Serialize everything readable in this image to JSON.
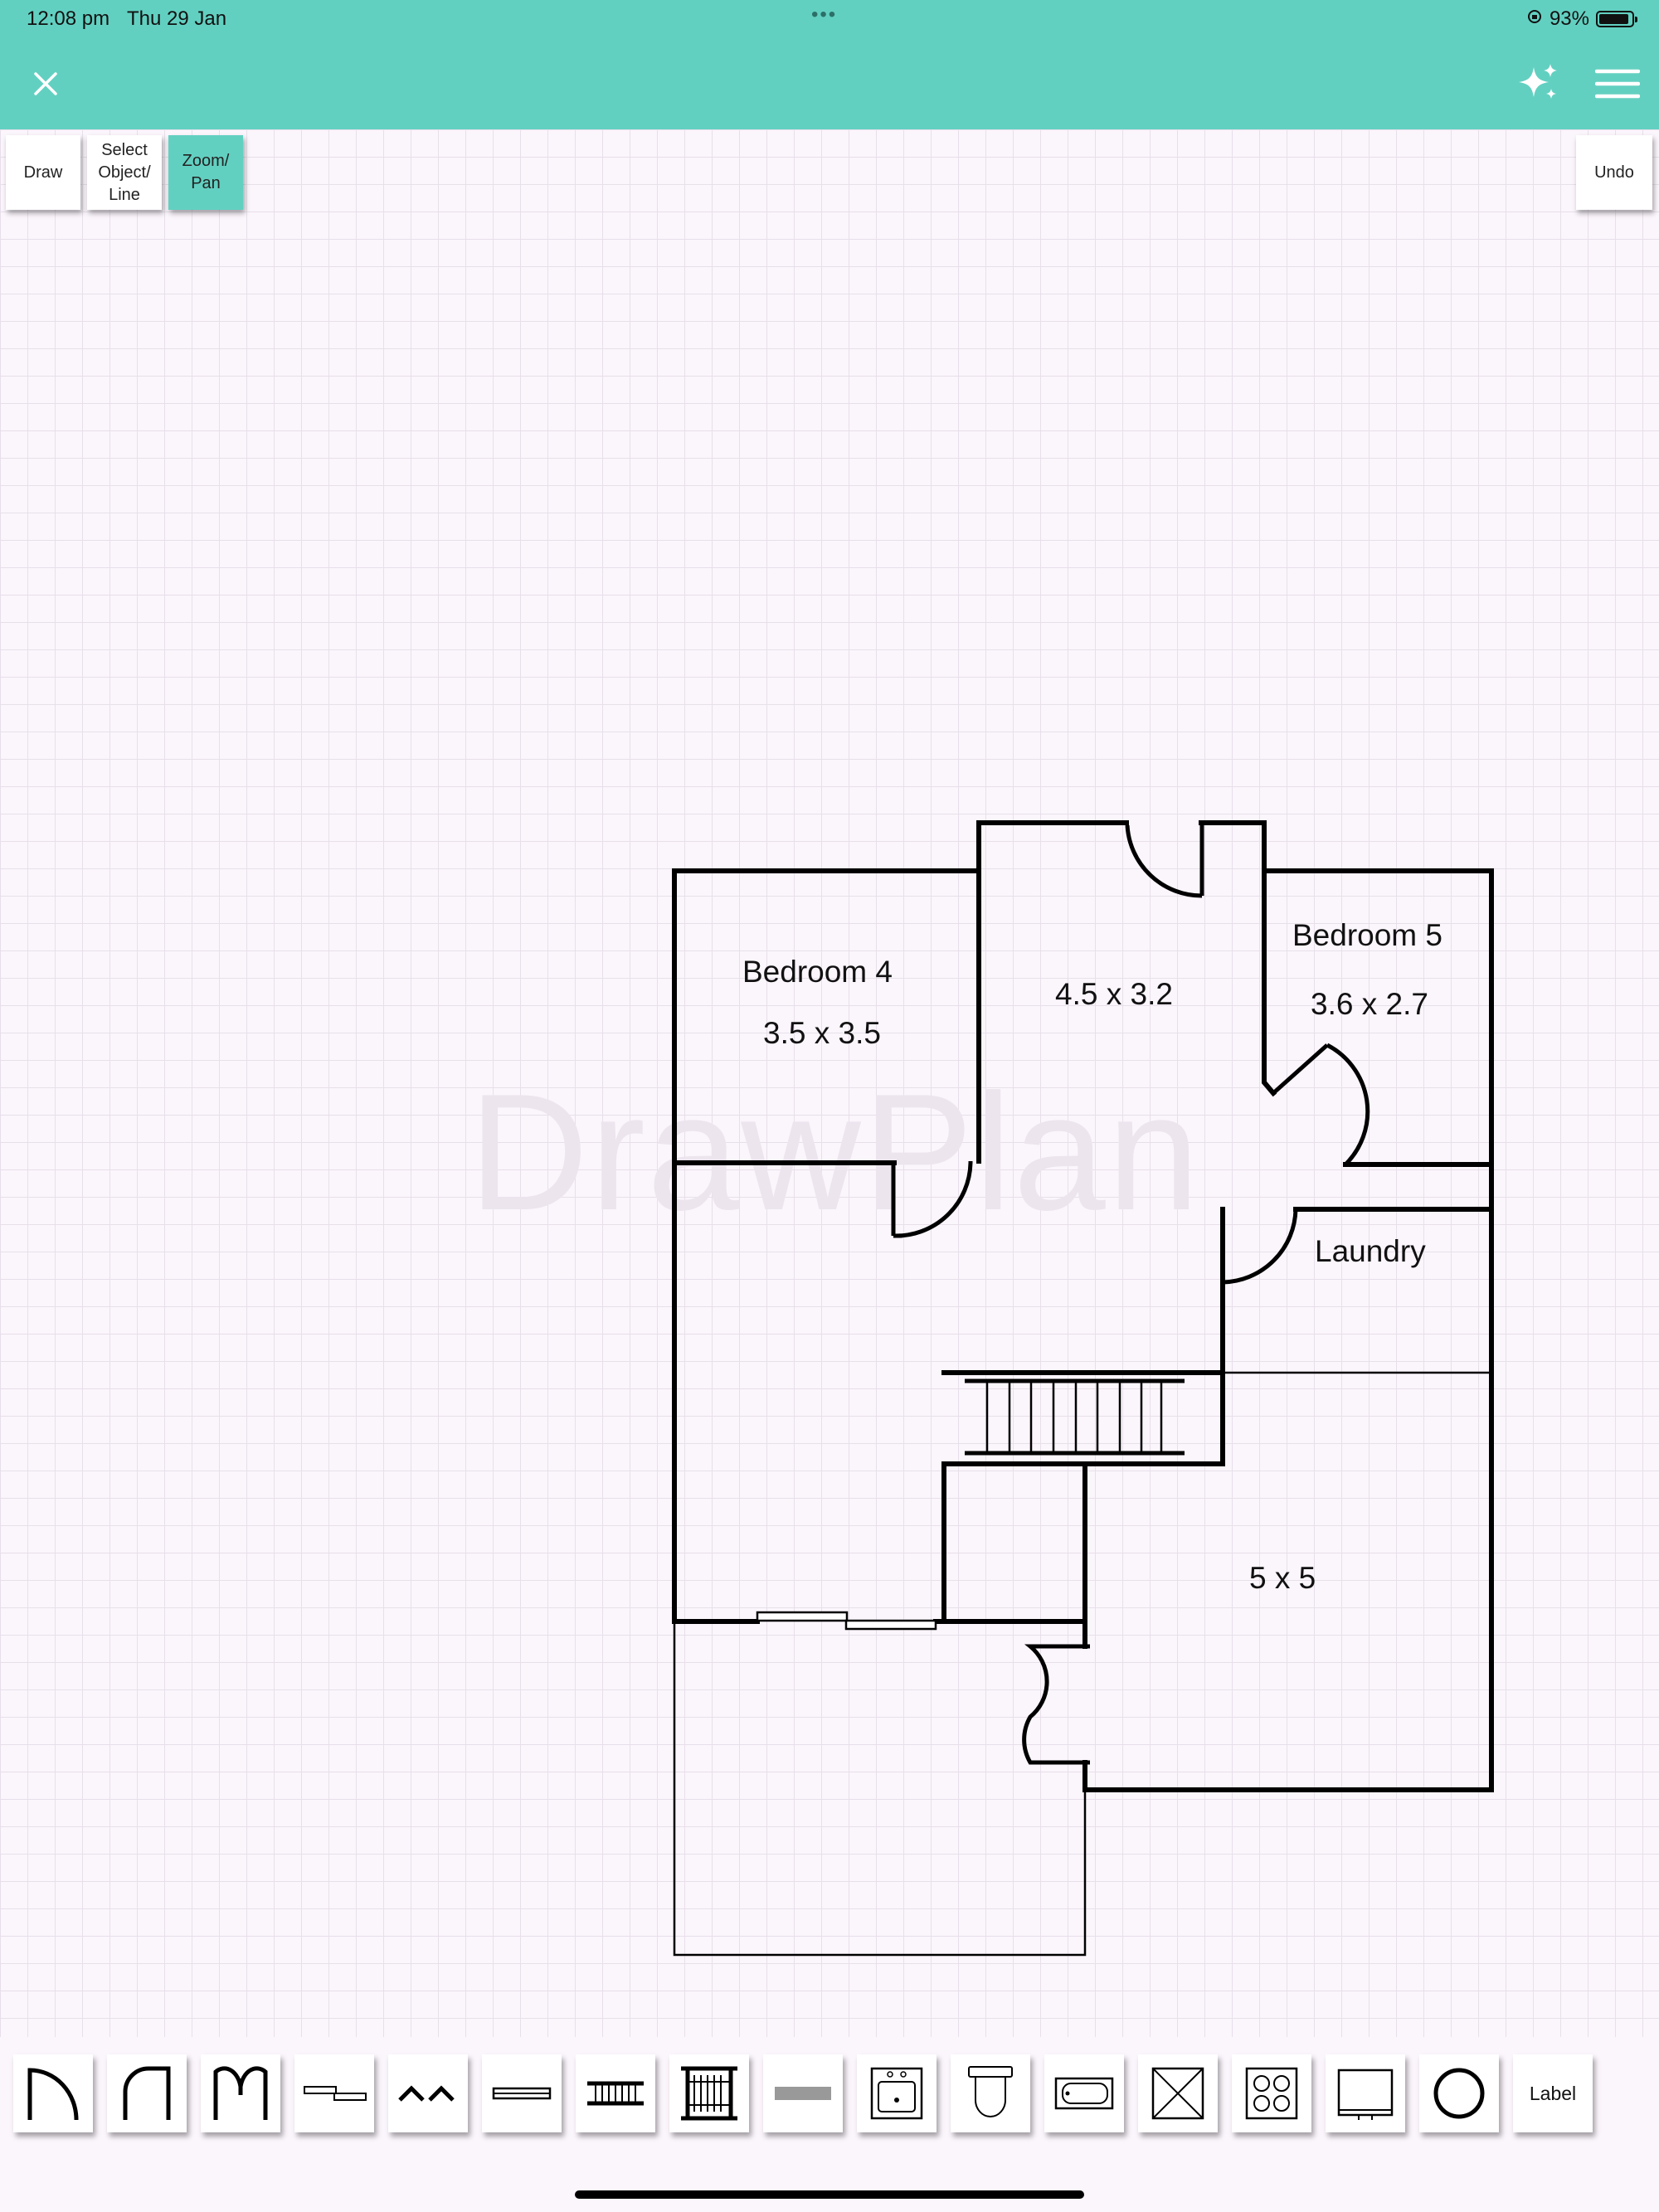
{
  "status_bar": {
    "time": "12:08 pm",
    "date": "Thu 29 Jan",
    "battery_text": "93%",
    "battery_level": 0.93
  },
  "app_bar": {
    "close_icon": "close-icon",
    "sparkle_icon": "sparkle-icon",
    "menu_icon": "hamburger-menu-icon",
    "color": "#62d0c1"
  },
  "tools": {
    "draw": "Draw",
    "select": "Select Object/ Line",
    "zoom": "Zoom/ Pan",
    "undo": "Undo"
  },
  "watermark": "DrawPlan",
  "rooms": {
    "bedroom4_name": "Bedroom 4",
    "bedroom4_size": "3.5 x 3.5",
    "center_size": "4.5 x 3.2",
    "bedroom5_name": "Bedroom 5",
    "bedroom5_size": "3.6 x 2.7",
    "laundry_name": "Laundry",
    "big_room_size": "5 x 5"
  },
  "palette": {
    "items": [
      "door-icon",
      "half-door-icon",
      "double-door-icon",
      "sliding-door-icon",
      "bifold-door-icon",
      "window-icon",
      "stairs-icon",
      "stairs-vertical-icon",
      "wall-block-icon",
      "sink-icon",
      "toilet-icon",
      "bathtub-icon",
      "shower-icon",
      "cooktop-icon",
      "dishwasher-icon",
      "circle-icon"
    ],
    "label_button": "Label"
  }
}
